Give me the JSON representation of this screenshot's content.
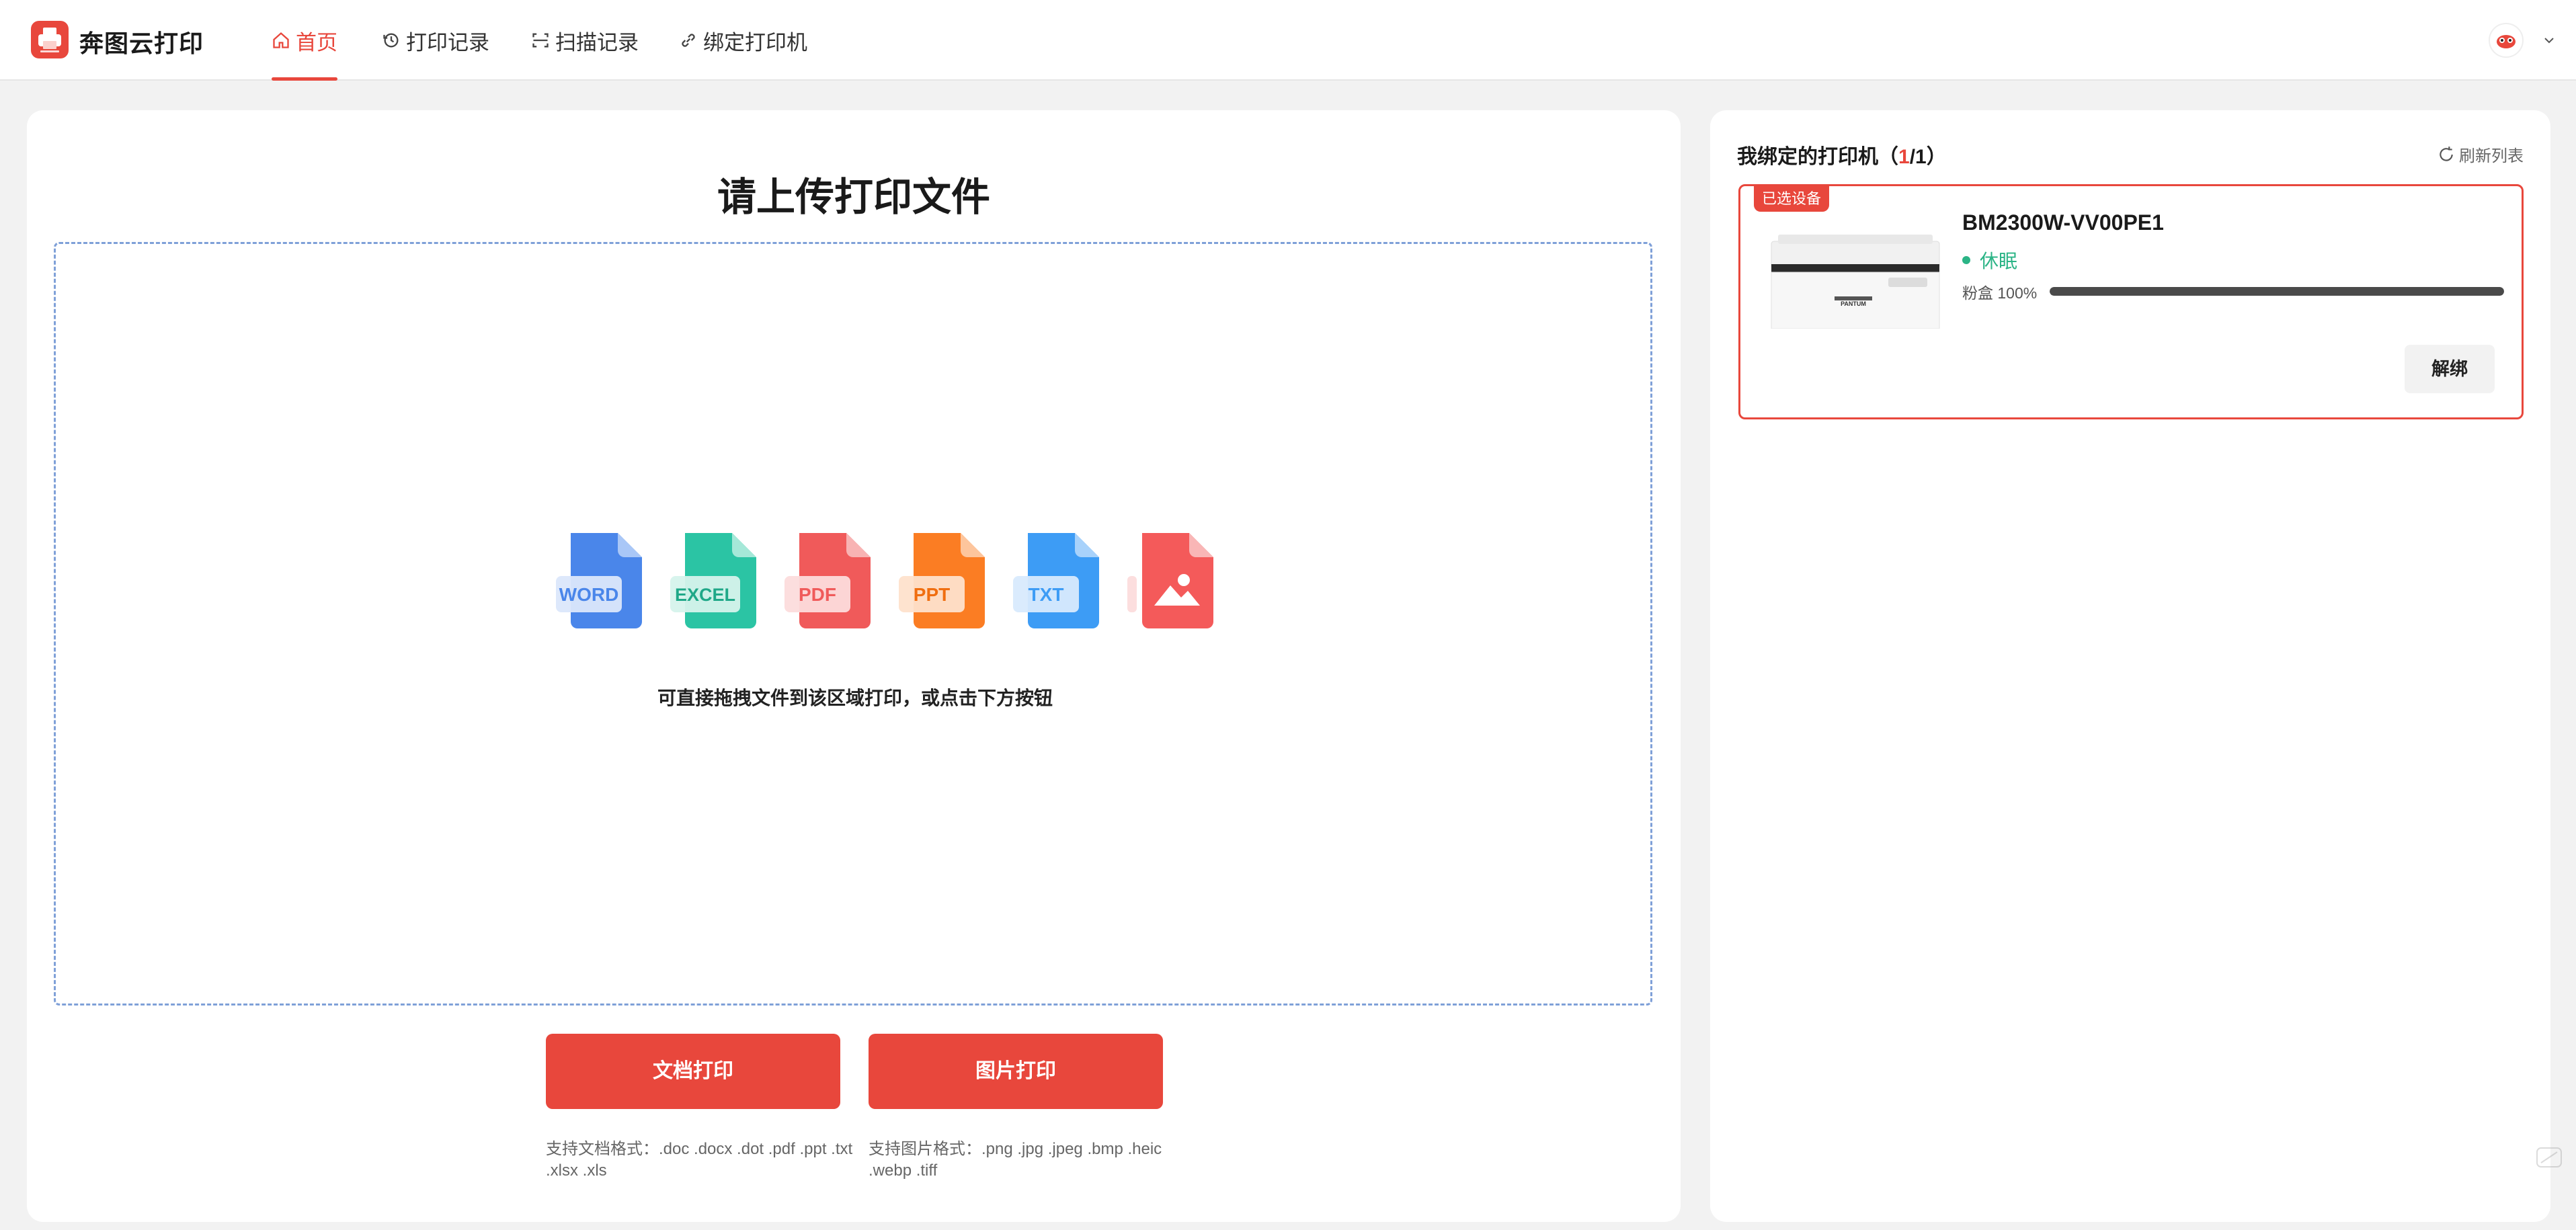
{
  "app": {
    "brand": "奔图云打印",
    "brand_color": "#e8473c"
  },
  "nav": {
    "items": [
      {
        "label": "首页",
        "icon": "home-icon",
        "active": true
      },
      {
        "label": "打印记录",
        "icon": "history-icon",
        "active": false
      },
      {
        "label": "扫描记录",
        "icon": "scan-icon",
        "active": false
      },
      {
        "label": "绑定打印机",
        "icon": "link-icon",
        "active": false
      }
    ]
  },
  "user": {
    "avatar_icon": "avatar-icon",
    "menu_icon": "chevron-down-icon"
  },
  "upload": {
    "title": "请上传打印文件",
    "file_types": [
      {
        "label": "WORD",
        "color": "#4a86ea"
      },
      {
        "label": "EXCEL",
        "color": "#2bc4a4"
      },
      {
        "label": "PDF",
        "color": "#f05a5a"
      },
      {
        "label": "PPT",
        "color": "#fb7d23"
      },
      {
        "label": "TXT",
        "color": "#3d9cf5"
      },
      {
        "label": "",
        "icon": "image-icon",
        "color": "#f45a5a"
      }
    ],
    "drop_hint": "可直接拖拽文件到该区域打印，或点击下方按钮",
    "doc_button": "文档打印",
    "img_button": "图片打印",
    "doc_formats": "支持文档格式：.doc .docx .dot .pdf .ppt .txt .xlsx .xls",
    "img_formats": "支持图片格式：.png .jpg .jpeg .bmp .heic .webp .tiff"
  },
  "printers": {
    "title_prefix": "我绑定的打印机（",
    "bound_count": "1",
    "title_sep": "/1）",
    "refresh_label": "刷新列表",
    "selected_tag": "已选设备",
    "device": {
      "name": "BM2300W-VV00PE1",
      "status": "休眠",
      "status_color": "#2bb486",
      "toner_label": "粉盒 100%",
      "toner_level": 1.0,
      "unbind_label": "解绑",
      "printer_brand": "PANTUM"
    }
  }
}
